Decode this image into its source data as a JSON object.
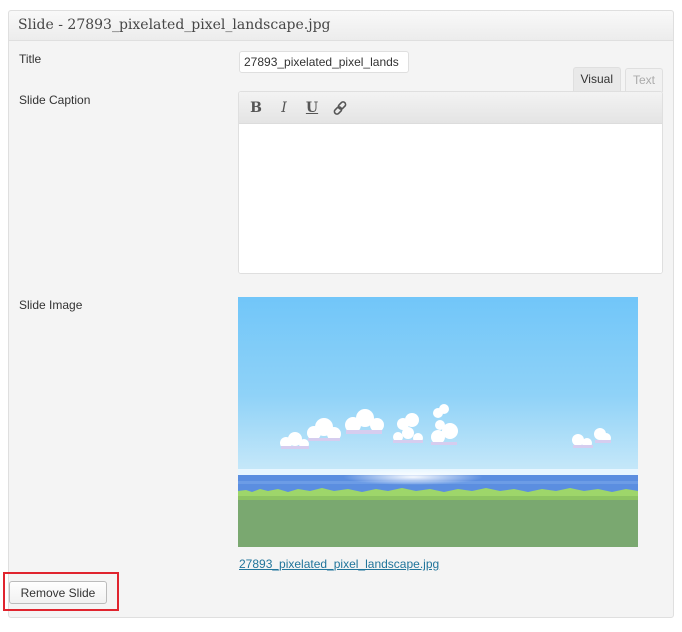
{
  "panel": {
    "title": "Slide - 27893_pixelated_pixel_landscape.jpg"
  },
  "fields": {
    "title_label": "Title",
    "title_value": "27893_pixelated_pixel_lands",
    "caption_label": "Slide Caption",
    "image_label": "Slide Image"
  },
  "editor": {
    "tabs": [
      {
        "label": "Visual",
        "active": true
      },
      {
        "label": "Text",
        "active": false
      }
    ],
    "toolbar": {
      "bold": "B",
      "italic": "I",
      "underline": "U",
      "link_icon": "link-icon"
    },
    "content": ""
  },
  "image": {
    "link_text": "27893_pixelated_pixel_landscape.jpg",
    "colors": {
      "sky_top": "#71c6f9",
      "sky_bottom": "#c9e9f9",
      "sea": "#5b8ee0",
      "horizon_glow": "#e8f6ff",
      "grass_light": "#9ed66a",
      "grass": "#7aa870",
      "cloud": "#ffffff",
      "cloud_shadow": "#d6cdef"
    }
  },
  "actions": {
    "remove_label": "Remove Slide"
  },
  "annotation": {
    "highlight_color": "#e0242e"
  }
}
